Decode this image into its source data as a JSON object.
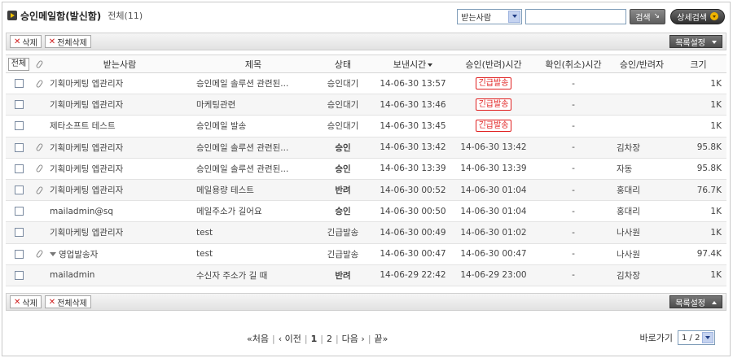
{
  "header": {
    "title": "승인메일함(발신함)",
    "count": "전체(11)"
  },
  "search": {
    "field_selected": "받는사람",
    "query": "",
    "search_label": "검색",
    "advanced_label": "상세검색"
  },
  "toolbar": {
    "delete_label": "삭제",
    "delete_all_label": "전체삭제",
    "list_settings_label": "목록설정"
  },
  "table": {
    "columns": {
      "all": "전체",
      "recipient": "받는사람",
      "subject": "제목",
      "status": "상태",
      "sent": "보낸시간",
      "approved": "승인(반려)시간",
      "confirmed": "확인(취소)시간",
      "approver": "승인/반려자",
      "size": "크기"
    },
    "rows": [
      {
        "attach": true,
        "recipient": "기획마케팅 엡관리자",
        "subject": "승인메일 솔루션 관련된...",
        "status": "승인대기",
        "status_type": "wait",
        "sent": "14-06-30 13:57",
        "approved": "긴급발송",
        "approved_badge": true,
        "confirmed": "-",
        "approver": "",
        "size": "1K"
      },
      {
        "attach": false,
        "recipient": "기획마케팅 엡관리자",
        "subject": "마케팅관련",
        "status": "승인대기",
        "status_type": "wait",
        "sent": "14-06-30 13:46",
        "approved": "긴급발송",
        "approved_badge": true,
        "confirmed": "-",
        "approver": "",
        "size": "1K"
      },
      {
        "attach": false,
        "recipient": "제타소프트 테스트",
        "subject": "승인메일 발송",
        "status": "승인대기",
        "status_type": "wait",
        "sent": "14-06-30 13:45",
        "approved": "긴급발송",
        "approved_badge": true,
        "confirmed": "-",
        "approver": "",
        "size": "1K"
      },
      {
        "attach": true,
        "recipient": "기획마케팅 엡관리자",
        "subject": "승인메일 솔루션 관련된...",
        "status": "승인",
        "status_type": "ok",
        "sent": "14-06-30 13:42",
        "approved": "14-06-30 13:42",
        "approved_badge": false,
        "confirmed": "-",
        "approver": "김차장",
        "size": "95.8K"
      },
      {
        "attach": true,
        "recipient": "기획마케팅 엡관리자",
        "subject": "승인메일 솔루션 관련된...",
        "status": "승인",
        "status_type": "ok",
        "sent": "14-06-30 13:39",
        "approved": "14-06-30 13:39",
        "approved_badge": false,
        "confirmed": "-",
        "approver": "자동",
        "size": "95.8K"
      },
      {
        "attach": true,
        "recipient": "기획마케팅 엡관리자",
        "subject": "메일용량 테스트",
        "status": "반려",
        "status_type": "rej",
        "sent": "14-06-30 00:52",
        "approved": "14-06-30 01:04",
        "approved_badge": false,
        "confirmed": "-",
        "approver": "홍대리",
        "size": "76.7K"
      },
      {
        "attach": false,
        "recipient": "mailadmin@sq",
        "subject": "메일주소가 길어요",
        "status": "승인",
        "status_type": "ok",
        "sent": "14-06-30 00:50",
        "approved": "14-06-30 01:04",
        "approved_badge": false,
        "confirmed": "-",
        "approver": "홍대리",
        "size": "1K"
      },
      {
        "attach": false,
        "recipient": "기획마케팅 엡관리자",
        "subject": "test",
        "status": "긴급발송",
        "status_type": "urg",
        "sent": "14-06-30 00:49",
        "approved": "14-06-30 01:02",
        "approved_badge": false,
        "confirmed": "-",
        "approver": "나사원",
        "size": "1K"
      },
      {
        "attach": true,
        "group": true,
        "recipient": "영업발송자",
        "subject": "test",
        "status": "긴급발송",
        "status_type": "urg",
        "sent": "14-06-30 00:47",
        "approved": "14-06-30 00:47",
        "approved_badge": false,
        "confirmed": "-",
        "approver": "나사원",
        "size": "97.4K"
      },
      {
        "attach": false,
        "recipient": "mailadmin",
        "subject": "수신자 주소가 길 때",
        "status": "반려",
        "status_type": "rej",
        "sent": "14-06-29 22:42",
        "approved": "14-06-29 23:00",
        "approved_badge": false,
        "confirmed": "-",
        "approver": "김차장",
        "size": "1K"
      }
    ]
  },
  "pager": {
    "first": "처음",
    "prev": "이전",
    "pages": [
      "1",
      "2"
    ],
    "next": "다음",
    "last": "끝"
  },
  "goto": {
    "label": "바로가기",
    "selected": "1 / 2"
  }
}
